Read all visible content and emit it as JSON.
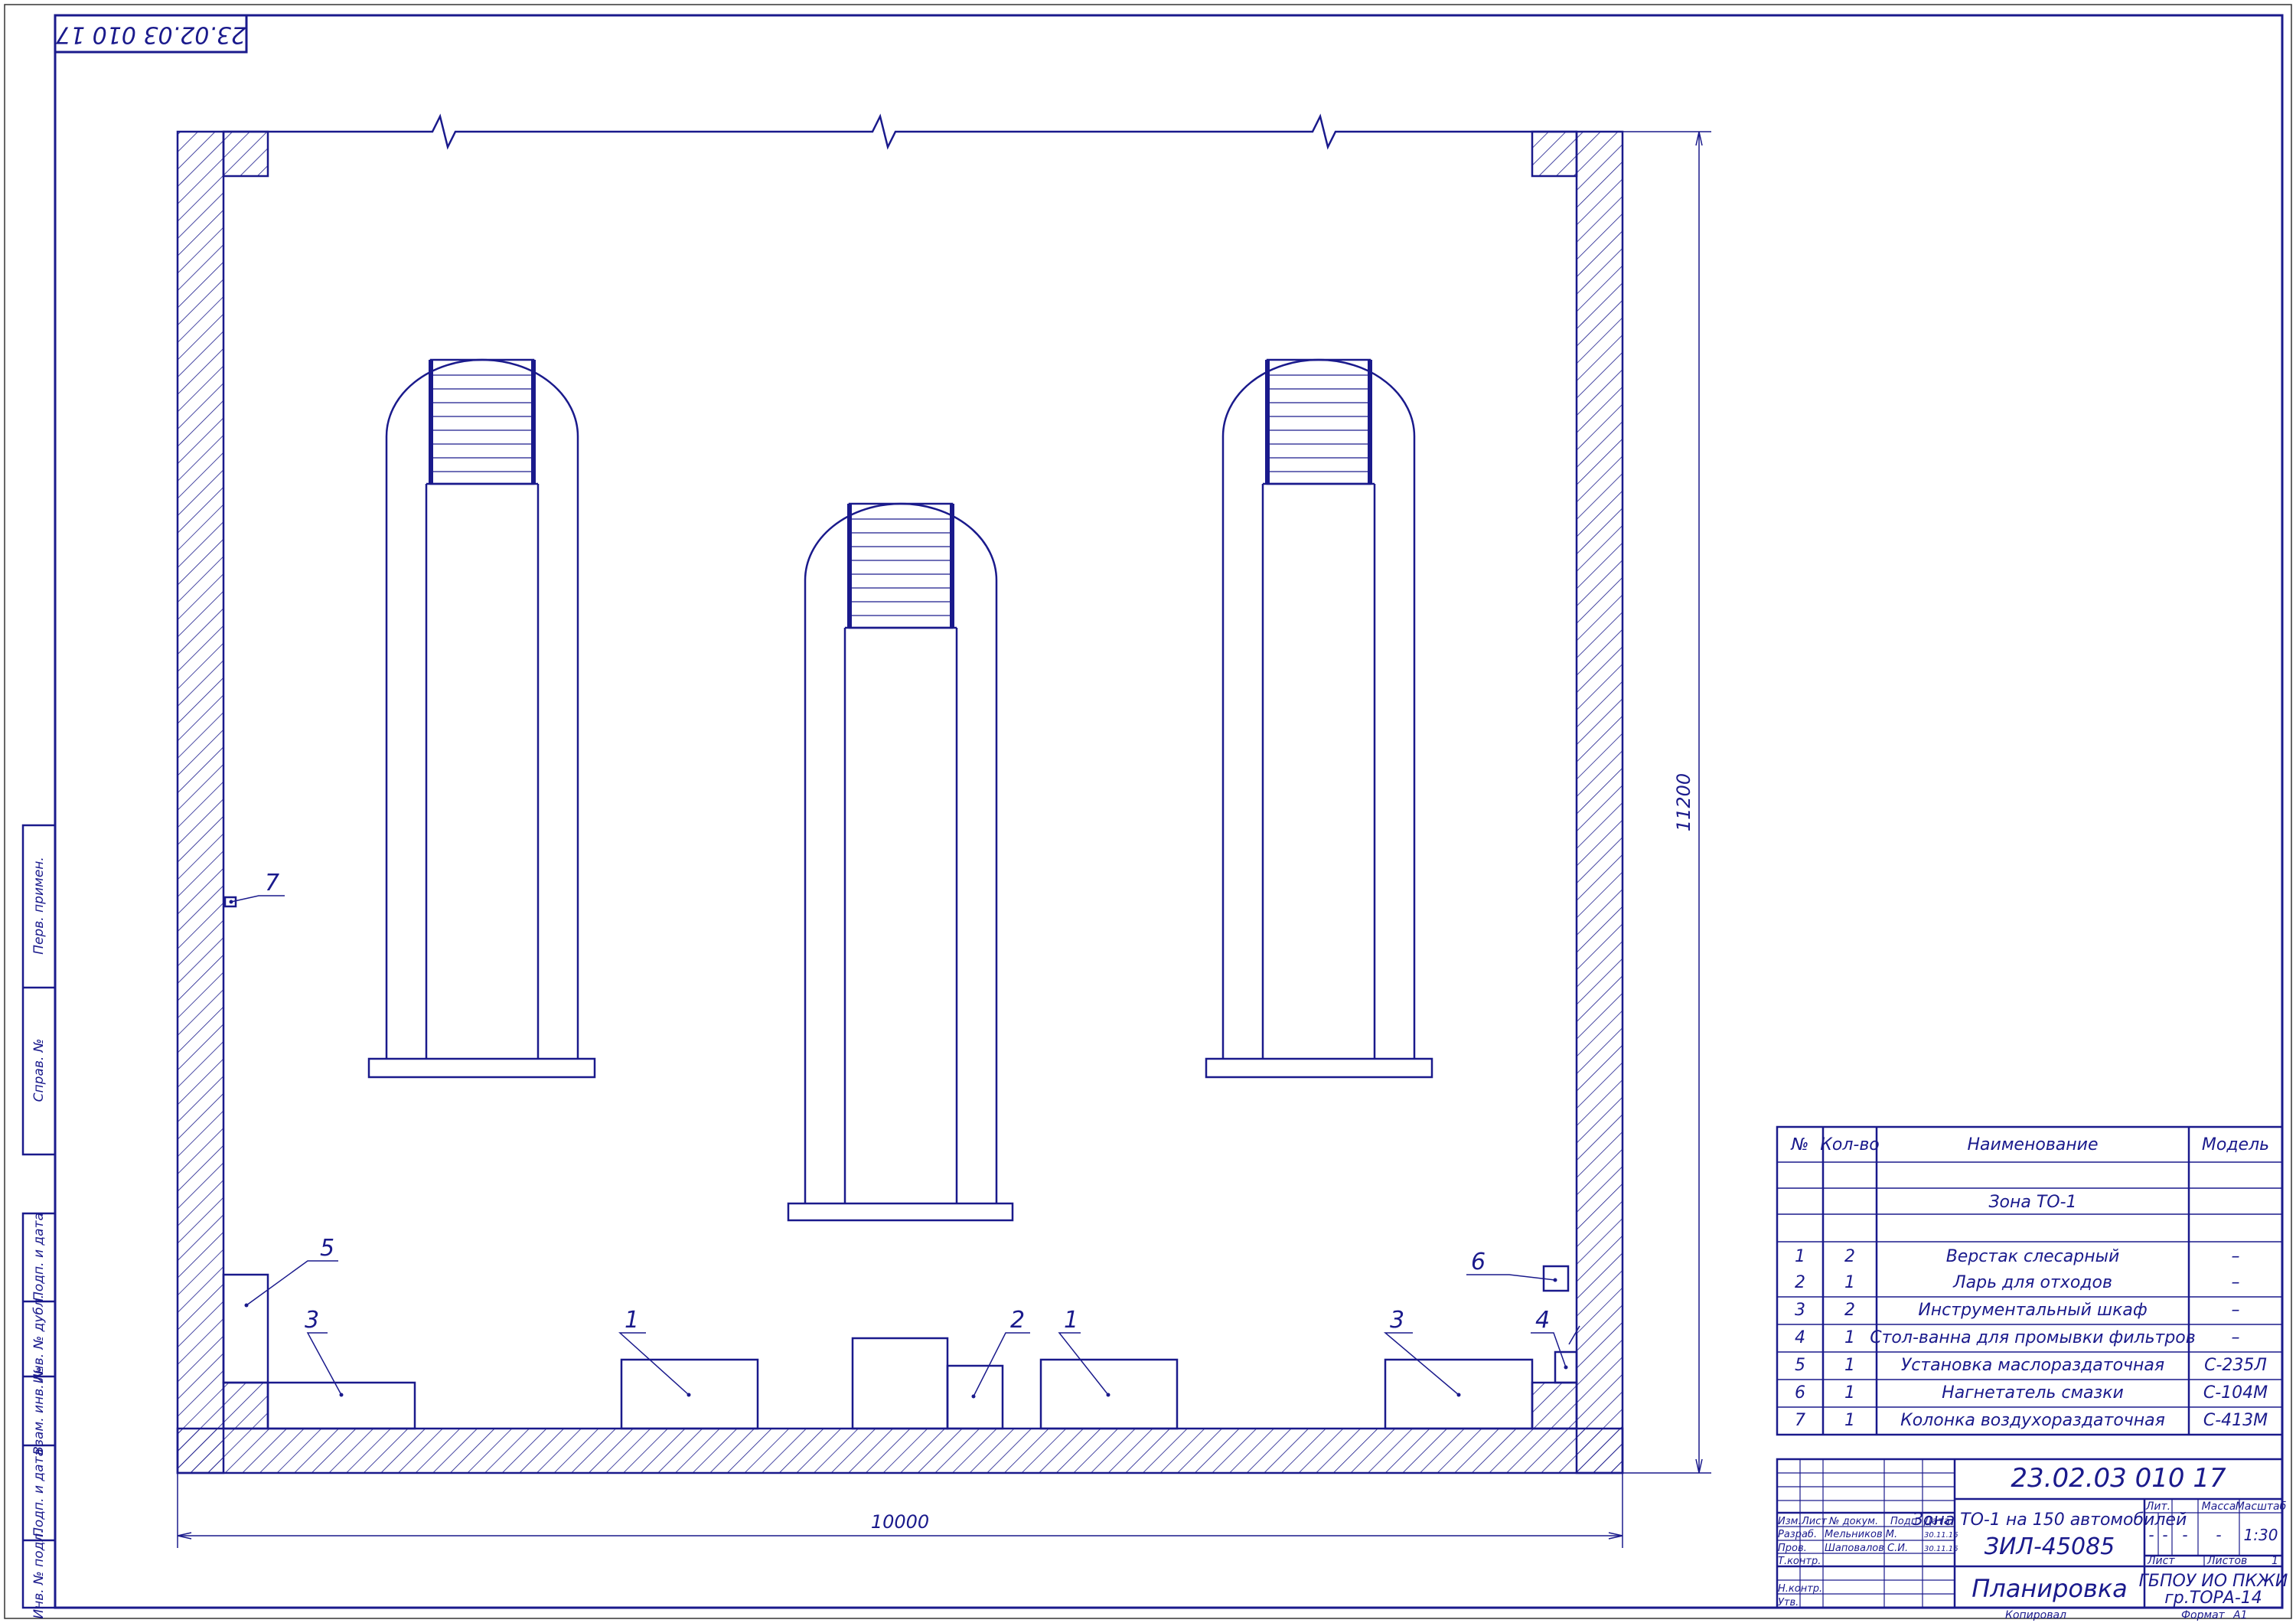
{
  "stamp": {
    "code_rotated": "23.02.03 010 17"
  },
  "dimensions": {
    "width": "10000",
    "height": "11200"
  },
  "callouts": [
    "7",
    "5",
    "3",
    "1",
    "2",
    "1",
    "3",
    "6",
    "4"
  ],
  "colors": {
    "line": "#1a1a8c",
    "hatch": "#1a1a8c",
    "background": "#ffffff"
  },
  "side_labels": [
    "Перв. примен.",
    "Справ. №",
    "Подп. и дата",
    "Инв. № дубл.",
    "Взам. инв. №",
    "Подп. и дата",
    "Инв. № подл."
  ],
  "spec": {
    "headers": {
      "no": "№",
      "qty": "Кол-во",
      "name": "Наименование",
      "model": "Модель"
    },
    "section": "Зона ТО-1",
    "rows": [
      {
        "no": "1",
        "qty": "2",
        "name": "Верстак слесарный",
        "model": "–"
      },
      {
        "no": "2",
        "qty": "1",
        "name": "Ларь для отходов",
        "model": "–"
      },
      {
        "no": "3",
        "qty": "2",
        "name": "Инструментальный шкаф",
        "model": "–"
      },
      {
        "no": "4",
        "qty": "1",
        "name": "Стол-ванна для промывки фильтров",
        "model": "–"
      },
      {
        "no": "5",
        "qty": "1",
        "name": "Установка маслораздаточная",
        "model": "С-235Л"
      },
      {
        "no": "6",
        "qty": "1",
        "name": "Нагнетатель смазки",
        "model": "С-104М"
      },
      {
        "no": "7",
        "qty": "1",
        "name": "Колонка воздухораздаточная",
        "model": "С-413М"
      }
    ]
  },
  "title_block": {
    "doc_number": "23.02.03 010 17",
    "title_line1": "Зона ТО-1 на 150 автомобилей",
    "title_line2": "ЗИЛ-45085",
    "sheet_name": "Планировка",
    "org_line1": "ГБПОУ ИО ПКЖИ",
    "org_line2": "гр.ТОРА-14",
    "col_izm": "Изм.",
    "col_list": "Лист",
    "col_doc": "№ докум.",
    "col_sign": "Подп.",
    "col_date": "Дата",
    "role_razrab": "Разраб.",
    "role_prov": "Пров.",
    "role_tkontr": "Т.контр.",
    "role_nkontr": "Н.контр.",
    "role_utv": "Утв.",
    "name_razrab": "Мельников М.",
    "name_prov": "Шаповалов С.И.",
    "date_razrab": "30.11.16",
    "date_prov": "30.11.16",
    "lit_label": "Лит.",
    "mass_label": "Масса",
    "scale_label": "Масштаб",
    "lit_values": [
      "-",
      "-",
      "-"
    ],
    "mass_value": "-",
    "scale_value": "1:30",
    "sheet_label": "Лист",
    "sheets_label": "Листов",
    "sheets_value": "1",
    "copied": "Копировал",
    "format_label": "Формат",
    "format_value": "A1"
  }
}
